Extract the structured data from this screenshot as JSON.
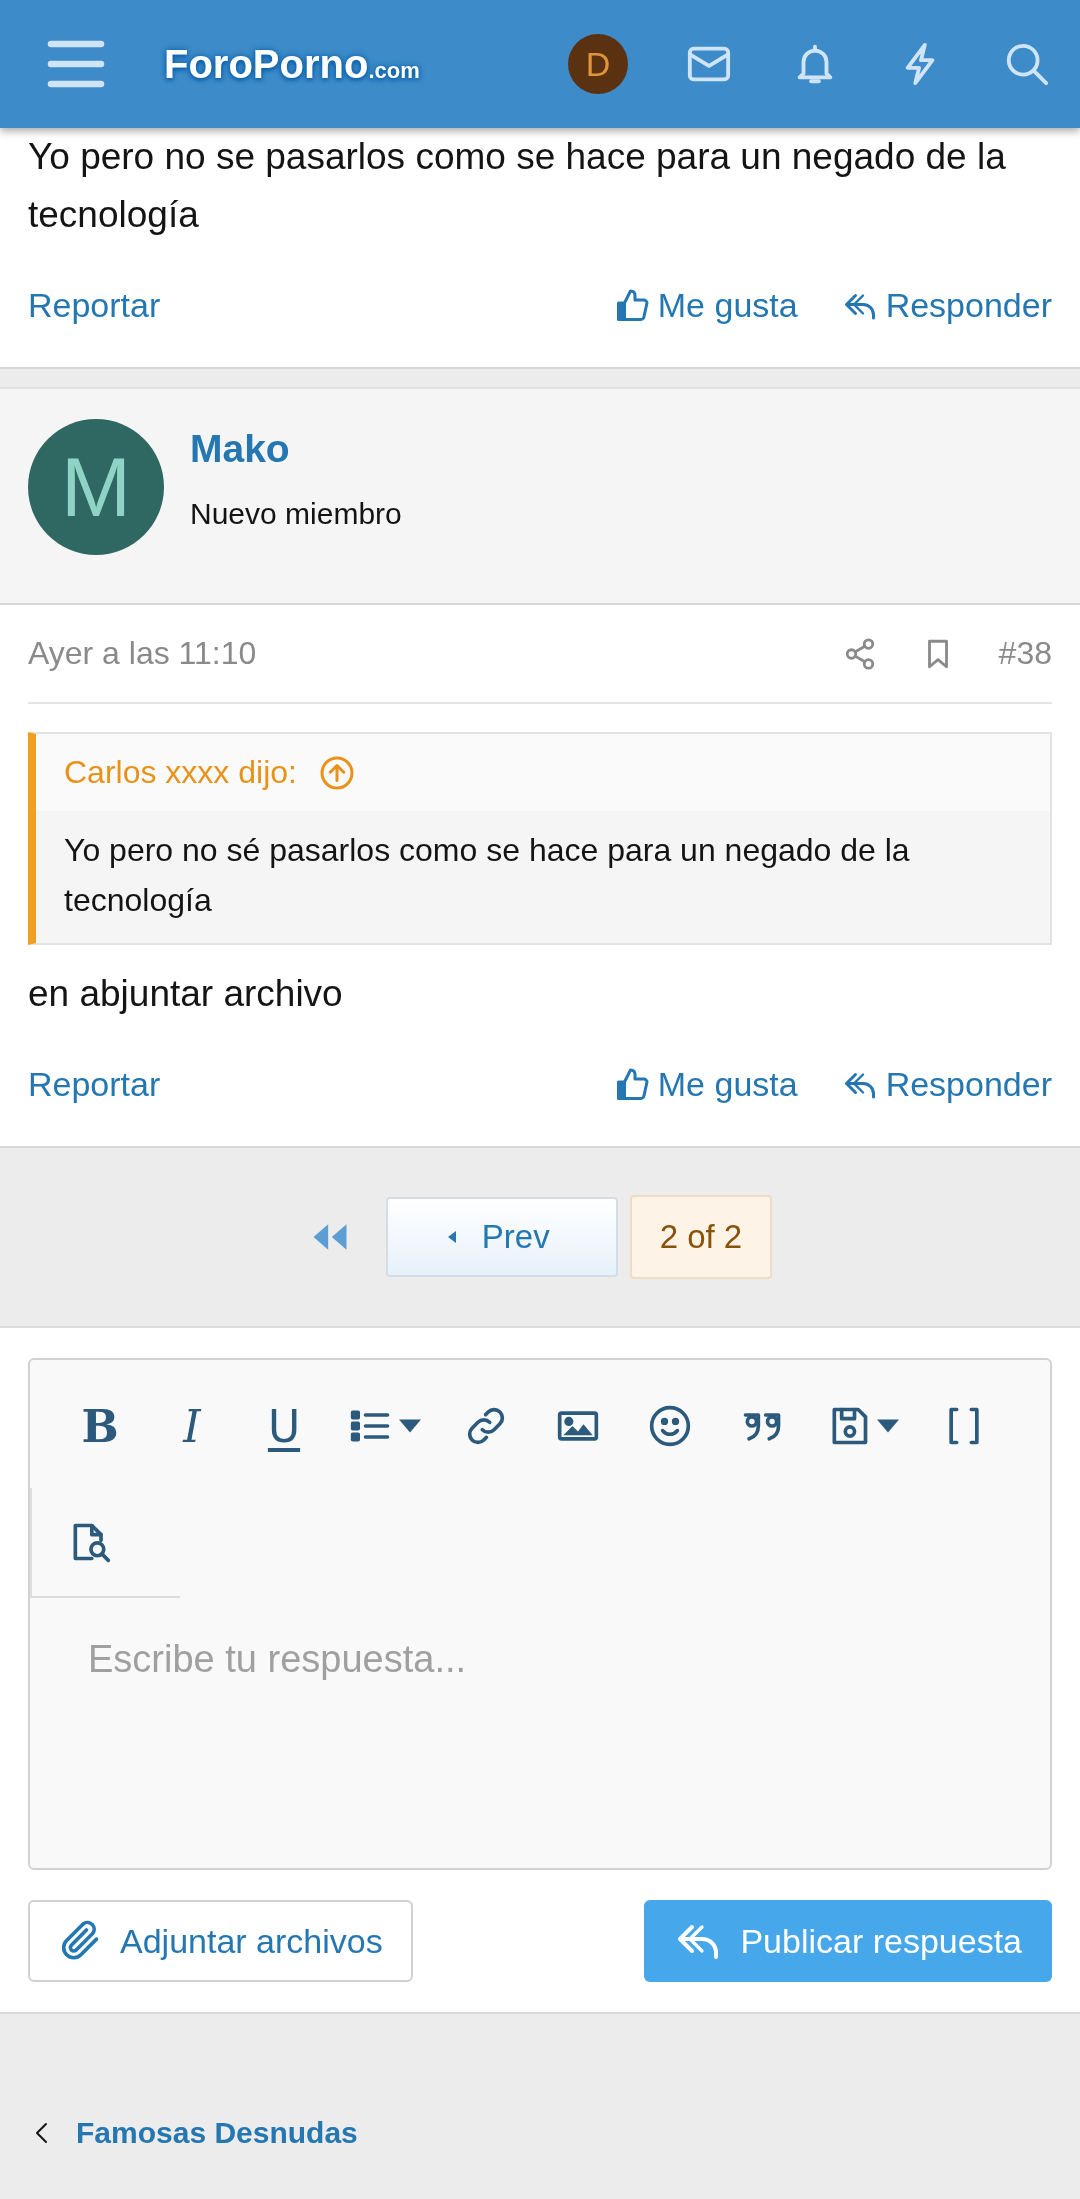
{
  "header": {
    "logo": "ForoPorno",
    "logo_suffix": ".com",
    "avatar_letter": "D"
  },
  "posts": [
    {
      "kind": "partial",
      "body": "Yo pero no se pasarlos como se hace para un negado de la tecnología",
      "actions": [
        "Reportar",
        "Me gusta",
        "Responder"
      ]
    },
    {
      "kind": "full",
      "author": "Mako",
      "role": "Nuevo miembro",
      "avatar_letter": "M",
      "date": "Ayer a las 11:10",
      "number": "#38",
      "quote": {
        "author": "Carlos xxxx dijo:",
        "text": "Yo pero no sé pasarlos como se hace para un negado de la tecnología"
      },
      "body": "en abjuntar archivo",
      "actions": [
        "Reportar",
        "Me gusta",
        "Responder"
      ]
    }
  ],
  "pagination": {
    "prev": "Prev",
    "current": "2 of 2"
  },
  "editor": {
    "toolbar": [
      {
        "kind": "bold",
        "label": "B"
      },
      {
        "kind": "italic",
        "label": "I"
      },
      {
        "kind": "underline",
        "label": "U"
      },
      {
        "kind": "list"
      },
      {
        "kind": "link"
      },
      {
        "kind": "image"
      },
      {
        "kind": "smile"
      },
      {
        "kind": "quote"
      },
      {
        "kind": "save"
      },
      {
        "kind": "brackets"
      },
      {
        "kind": "preview"
      }
    ],
    "placeholder": "Escribe tu respuesta...",
    "attach": "Adjuntar archivos",
    "submit": "Publicar respuesta"
  },
  "breadcrumb": {
    "label": "Famosas Desnudas"
  }
}
